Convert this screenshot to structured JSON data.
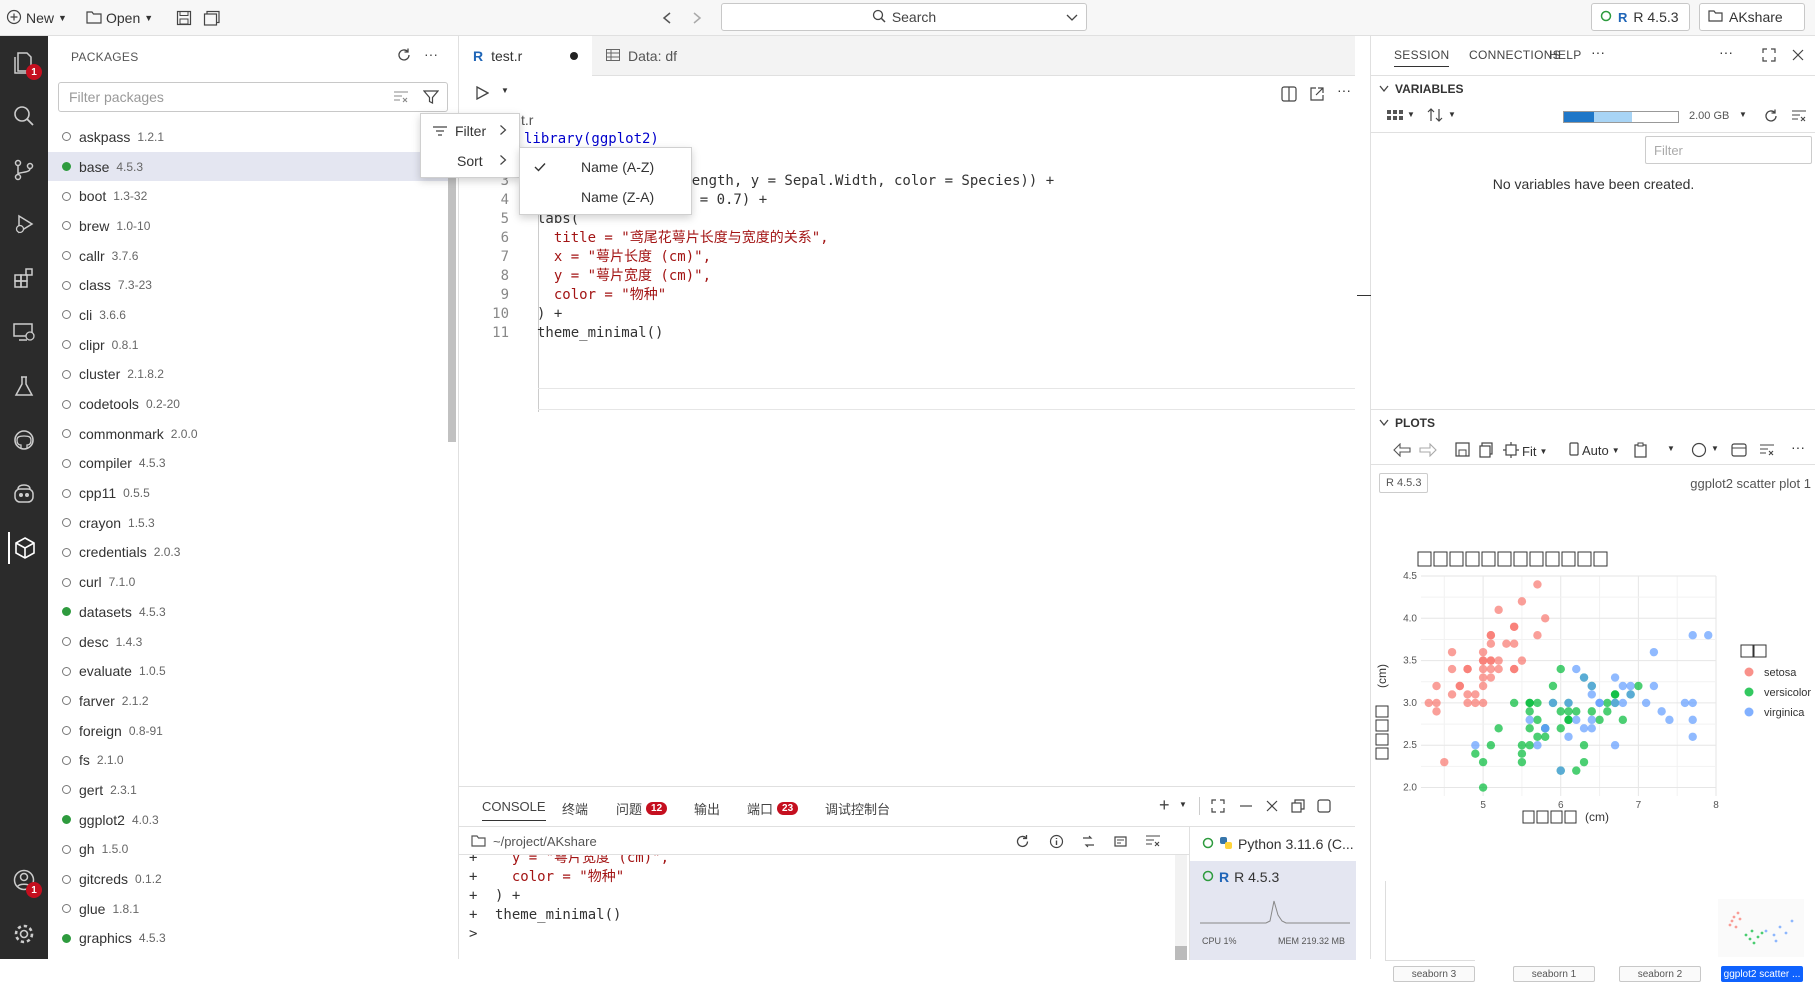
{
  "topbar": {
    "new_label": "New",
    "open_label": "Open",
    "search_label": "Search",
    "interpreter_label": "R 4.5.3",
    "project_label": "AKshare"
  },
  "activity": {
    "explorer_badge": "1",
    "account_badge": "1"
  },
  "packages": {
    "title": "PACKAGES",
    "filter_placeholder": "Filter packages",
    "items": [
      {
        "name": "askpass",
        "version": "1.2.1",
        "loaded": false
      },
      {
        "name": "base",
        "version": "4.5.3",
        "loaded": true
      },
      {
        "name": "boot",
        "version": "1.3-32",
        "loaded": false
      },
      {
        "name": "brew",
        "version": "1.0-10",
        "loaded": false
      },
      {
        "name": "callr",
        "version": "3.7.6",
        "loaded": false
      },
      {
        "name": "class",
        "version": "7.3-23",
        "loaded": false
      },
      {
        "name": "cli",
        "version": "3.6.6",
        "loaded": false
      },
      {
        "name": "clipr",
        "version": "0.8.1",
        "loaded": false
      },
      {
        "name": "cluster",
        "version": "2.1.8.2",
        "loaded": false
      },
      {
        "name": "codetools",
        "version": "0.2-20",
        "loaded": false
      },
      {
        "name": "commonmark",
        "version": "2.0.0",
        "loaded": false
      },
      {
        "name": "compiler",
        "version": "4.5.3",
        "loaded": false
      },
      {
        "name": "cpp11",
        "version": "0.5.5",
        "loaded": false
      },
      {
        "name": "crayon",
        "version": "1.5.3",
        "loaded": false
      },
      {
        "name": "credentials",
        "version": "2.0.3",
        "loaded": false
      },
      {
        "name": "curl",
        "version": "7.1.0",
        "loaded": false
      },
      {
        "name": "datasets",
        "version": "4.5.3",
        "loaded": true
      },
      {
        "name": "desc",
        "version": "1.4.3",
        "loaded": false
      },
      {
        "name": "evaluate",
        "version": "1.0.5",
        "loaded": false
      },
      {
        "name": "farver",
        "version": "2.1.2",
        "loaded": false
      },
      {
        "name": "foreign",
        "version": "0.8-91",
        "loaded": false
      },
      {
        "name": "fs",
        "version": "2.1.0",
        "loaded": false
      },
      {
        "name": "gert",
        "version": "2.3.1",
        "loaded": false
      },
      {
        "name": "ggplot2",
        "version": "4.0.3",
        "loaded": true
      },
      {
        "name": "gh",
        "version": "1.5.0",
        "loaded": false
      },
      {
        "name": "gitcreds",
        "version": "0.1.2",
        "loaded": false
      },
      {
        "name": "glue",
        "version": "1.8.1",
        "loaded": false
      },
      {
        "name": "graphics",
        "version": "4.5.3",
        "loaded": true
      }
    ]
  },
  "menu": {
    "filter_label": "Filter",
    "sort_label": "Sort",
    "sort_options": [
      {
        "label": "Name (A-Z)",
        "checked": true
      },
      {
        "label": "Name (Z-A)",
        "checked": false
      }
    ]
  },
  "editor": {
    "tabs": [
      {
        "label": "test.r"
      },
      {
        "label": "Data: df"
      }
    ],
    "path_fragment": "t.r",
    "lines": [
      {
        "n": "",
        "t": "library(ggplot2)"
      },
      {
        "n": "",
        "t": ""
      },
      {
        "n": "3",
        "t": "x = Sepal.Length, y = Sepal.Width, color = Species)) +"
      },
      {
        "n": "4",
        "t": "= 3, alpha = 0.7) +"
      },
      {
        "n": "5",
        "t": "labs("
      },
      {
        "n": "6",
        "t": "  title = \"鸢尾花萼片长度与宽度的关系\","
      },
      {
        "n": "7",
        "t": "  x = \"萼片长度 (cm)\","
      },
      {
        "n": "8",
        "t": "  y = \"萼片宽度 (cm)\","
      },
      {
        "n": "9",
        "t": "  color = \"物种\""
      },
      {
        "n": "10",
        "t": ") +"
      },
      {
        "n": "11",
        "t": "theme_minimal()"
      }
    ]
  },
  "console": {
    "tabs": [
      "CONSOLE",
      "终端",
      "问题",
      "输出",
      "端口",
      "调试控制台"
    ],
    "problems_count": "12",
    "ports_count": "23",
    "path": "~/project/AKshare",
    "lines": [
      {
        "p": "+",
        "t": "  y = \"萼片宽度 (cm)\","
      },
      {
        "p": "+",
        "t": "  color = \"物种\""
      },
      {
        "p": "+",
        "t": ") +"
      },
      {
        "p": "+",
        "t": "theme_minimal()"
      },
      {
        "p": ">",
        "t": ""
      }
    ],
    "sessions": [
      {
        "label": "Python 3.11.6 (C..."
      },
      {
        "label": "R 4.5.3"
      }
    ],
    "cpu_label": "CPU 1%",
    "mem_label": "MEM 219.32 MB"
  },
  "right": {
    "tabs": [
      "SESSION",
      "CONNECTIONS",
      "HELP"
    ],
    "variables_title": "VARIABLES",
    "memory_label": "2.00 GB",
    "memory_fraction": 0.6,
    "filter_placeholder": "Filter",
    "empty_message": "No variables have been created.",
    "plots_title": "PLOTS",
    "fit_label": "Fit",
    "auto_label": "Auto",
    "plot_badge": "R 4.5.3",
    "plot_name": "ggplot2 scatter plot 1",
    "thumbnails": [
      "seaborn 3",
      "seaborn 1",
      "seaborn 2",
      "ggplot2 scatter ..."
    ]
  },
  "chart_data": {
    "type": "scatter",
    "title": "",
    "xlabel": "(cm)",
    "ylabel": "(cm)",
    "xlim": [
      4.2,
      8.0
    ],
    "ylim": [
      1.9,
      4.5
    ],
    "xticks": [
      "5",
      "6",
      "7",
      "8"
    ],
    "yticks": [
      "2.0",
      "2.5",
      "3.0",
      "3.5",
      "4.0",
      "4.5"
    ],
    "grid": true,
    "legend_position": "right",
    "series": [
      {
        "name": "setosa",
        "color": "#f8766d",
        "points": [
          [
            5.1,
            3.5
          ],
          [
            4.9,
            3.0
          ],
          [
            4.7,
            3.2
          ],
          [
            4.6,
            3.1
          ],
          [
            5.0,
            3.6
          ],
          [
            5.4,
            3.9
          ],
          [
            4.6,
            3.4
          ],
          [
            5.0,
            3.4
          ],
          [
            4.4,
            2.9
          ],
          [
            4.9,
            3.1
          ],
          [
            5.4,
            3.7
          ],
          [
            4.8,
            3.4
          ],
          [
            4.3,
            3.0
          ],
          [
            5.8,
            4.0
          ],
          [
            5.7,
            4.4
          ],
          [
            5.4,
            3.9
          ],
          [
            5.1,
            3.5
          ],
          [
            5.7,
            3.8
          ],
          [
            5.1,
            3.8
          ],
          [
            5.4,
            3.4
          ],
          [
            5.1,
            3.7
          ],
          [
            4.6,
            3.6
          ],
          [
            5.1,
            3.3
          ],
          [
            4.8,
            3.4
          ],
          [
            5.0,
            3.0
          ],
          [
            5.2,
            3.5
          ],
          [
            5.2,
            3.4
          ],
          [
            4.7,
            3.2
          ],
          [
            4.8,
            3.1
          ],
          [
            5.4,
            3.4
          ],
          [
            5.2,
            4.1
          ],
          [
            5.5,
            4.2
          ],
          [
            5.0,
            3.2
          ],
          [
            5.5,
            3.5
          ],
          [
            4.4,
            3.0
          ],
          [
            5.1,
            3.4
          ],
          [
            5.0,
            3.5
          ],
          [
            4.5,
            2.3
          ],
          [
            4.4,
            3.2
          ],
          [
            5.0,
            3.5
          ],
          [
            5.1,
            3.8
          ],
          [
            4.8,
            3.0
          ],
          [
            5.3,
            3.7
          ],
          [
            5.0,
            3.3
          ]
        ]
      },
      {
        "name": "versicolor",
        "color": "#00ba38",
        "points": [
          [
            7.0,
            3.2
          ],
          [
            6.4,
            3.2
          ],
          [
            6.9,
            3.1
          ],
          [
            5.5,
            2.3
          ],
          [
            6.5,
            2.8
          ],
          [
            5.7,
            2.8
          ],
          [
            6.3,
            3.3
          ],
          [
            4.9,
            2.4
          ],
          [
            6.6,
            2.9
          ],
          [
            5.2,
            2.7
          ],
          [
            5.0,
            2.0
          ],
          [
            5.9,
            3.0
          ],
          [
            6.0,
            2.2
          ],
          [
            6.1,
            2.9
          ],
          [
            5.6,
            2.9
          ],
          [
            6.7,
            3.1
          ],
          [
            5.6,
            3.0
          ],
          [
            5.8,
            2.7
          ],
          [
            6.2,
            2.2
          ],
          [
            5.6,
            2.5
          ],
          [
            5.9,
            3.2
          ],
          [
            6.1,
            2.8
          ],
          [
            6.3,
            2.5
          ],
          [
            6.1,
            2.8
          ],
          [
            6.4,
            2.9
          ],
          [
            6.6,
            3.0
          ],
          [
            6.8,
            2.8
          ],
          [
            6.7,
            3.0
          ],
          [
            6.0,
            2.9
          ],
          [
            5.7,
            2.6
          ],
          [
            5.5,
            2.4
          ],
          [
            5.8,
            2.7
          ],
          [
            6.0,
            2.7
          ],
          [
            5.4,
            3.0
          ],
          [
            6.0,
            3.4
          ],
          [
            6.7,
            3.1
          ],
          [
            6.3,
            2.3
          ],
          [
            5.6,
            3.0
          ],
          [
            5.5,
            2.5
          ],
          [
            6.1,
            3.0
          ],
          [
            5.8,
            2.6
          ],
          [
            5.0,
            2.3
          ],
          [
            5.6,
            2.7
          ],
          [
            5.7,
            3.0
          ],
          [
            6.2,
            2.9
          ],
          [
            5.1,
            2.5
          ]
        ]
      },
      {
        "name": "virginica",
        "color": "#619cff",
        "points": [
          [
            6.3,
            3.3
          ],
          [
            5.8,
            2.7
          ],
          [
            7.1,
            3.0
          ],
          [
            6.5,
            3.0
          ],
          [
            7.6,
            3.0
          ],
          [
            4.9,
            2.5
          ],
          [
            7.3,
            2.9
          ],
          [
            6.7,
            2.5
          ],
          [
            7.2,
            3.6
          ],
          [
            6.4,
            2.7
          ],
          [
            6.8,
            3.0
          ],
          [
            5.7,
            2.5
          ],
          [
            6.4,
            3.2
          ],
          [
            7.7,
            3.8
          ],
          [
            7.7,
            2.6
          ],
          [
            6.0,
            2.2
          ],
          [
            6.9,
            3.2
          ],
          [
            5.6,
            2.8
          ],
          [
            7.7,
            2.8
          ],
          [
            6.3,
            2.7
          ],
          [
            6.7,
            3.3
          ],
          [
            7.2,
            3.2
          ],
          [
            6.2,
            2.8
          ],
          [
            6.1,
            3.0
          ],
          [
            7.4,
            2.8
          ],
          [
            7.9,
            3.8
          ],
          [
            6.4,
            2.8
          ],
          [
            6.1,
            2.6
          ],
          [
            7.7,
            3.0
          ],
          [
            6.4,
            3.1
          ],
          [
            6.9,
            3.1
          ],
          [
            5.8,
            2.7
          ],
          [
            6.8,
            3.2
          ],
          [
            6.7,
            3.0
          ],
          [
            6.5,
            3.0
          ],
          [
            6.2,
            3.4
          ],
          [
            5.9,
            3.0
          ]
        ]
      }
    ]
  }
}
